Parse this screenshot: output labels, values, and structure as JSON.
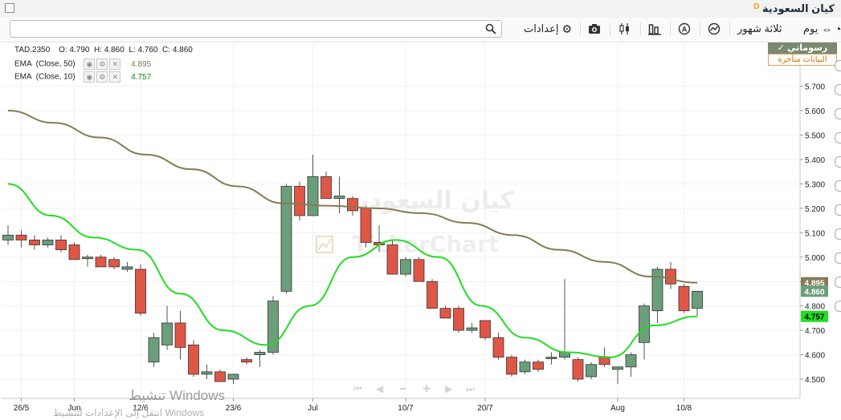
{
  "header": {
    "title": "كيان السعودية",
    "badge": "D"
  },
  "toolbar": {
    "period": "يوم",
    "range": "ثلاثة شهور",
    "settings": "إعدادات"
  },
  "legend": {
    "ticker": "TAD.2350",
    "ohlc": "O: 4.790  H: 4.860  L: 4.760  C: 4.860",
    "ema50_label": "EMA  (Close, 50)",
    "ema50_value": "4.895",
    "ema10_label": "EMA  (Close, 10)",
    "ema10_value": "4.757"
  },
  "realtime": {
    "live": "رسوماتي ✓",
    "delayed": "البيانات متأخرة"
  },
  "watermark": {
    "name": "كيان السعودية",
    "brand": "TickerChart"
  },
  "windows": {
    "line1": "تنشيط Windows",
    "line2": "انتقل إلى الإعدادات لتنشيط Windows"
  },
  "colors": {
    "up": "#6b9e7b",
    "down": "#e05646",
    "ema50": "#857b55",
    "ema10": "#22dd22"
  },
  "chart_data": {
    "type": "candlestick",
    "y_ticks": [
      "4.500",
      "4.600",
      "4.700",
      "4.800",
      "4.900",
      "5.000",
      "5.100",
      "5.200",
      "5.300",
      "5.400",
      "5.500",
      "5.600",
      "5.700"
    ],
    "ylim": [
      4.47,
      5.77
    ],
    "x_labels": [
      {
        "i": 1,
        "label": "26/5"
      },
      {
        "i": 5,
        "label": "Jun"
      },
      {
        "i": 10,
        "label": "12/6"
      },
      {
        "i": 17,
        "label": "23/6"
      },
      {
        "i": 23,
        "label": "Jul"
      },
      {
        "i": 30,
        "label": "10/7"
      },
      {
        "i": 36,
        "label": "20/7"
      },
      {
        "i": 46,
        "label": "Aug"
      },
      {
        "i": 51,
        "label": "10/8"
      }
    ],
    "candles": [
      {
        "o": 5.07,
        "h": 5.13,
        "l": 5.05,
        "c": 5.09
      },
      {
        "o": 5.09,
        "h": 5.11,
        "l": 5.04,
        "c": 5.07
      },
      {
        "o": 5.07,
        "h": 5.09,
        "l": 5.03,
        "c": 5.05
      },
      {
        "o": 5.05,
        "h": 5.08,
        "l": 5.04,
        "c": 5.07
      },
      {
        "o": 5.07,
        "h": 5.09,
        "l": 5.02,
        "c": 5.03
      },
      {
        "o": 5.05,
        "h": 5.06,
        "l": 4.99,
        "c": 4.99
      },
      {
        "o": 5.0,
        "h": 5.01,
        "l": 4.96,
        "c": 5.0
      },
      {
        "o": 5.0,
        "h": 5.01,
        "l": 4.96,
        "c": 4.96
      },
      {
        "o": 4.99,
        "h": 5.0,
        "l": 4.95,
        "c": 4.96
      },
      {
        "o": 4.95,
        "h": 4.98,
        "l": 4.94,
        "c": 4.96
      },
      {
        "o": 4.95,
        "h": 4.97,
        "l": 4.76,
        "c": 4.77
      },
      {
        "o": 4.57,
        "h": 4.69,
        "l": 4.55,
        "c": 4.67
      },
      {
        "o": 4.64,
        "h": 4.8,
        "l": 4.62,
        "c": 4.73
      },
      {
        "o": 4.73,
        "h": 4.78,
        "l": 4.58,
        "c": 4.63
      },
      {
        "o": 4.64,
        "h": 4.66,
        "l": 4.51,
        "c": 4.52
      },
      {
        "o": 4.52,
        "h": 4.56,
        "l": 4.5,
        "c": 4.53
      },
      {
        "o": 4.53,
        "h": 4.54,
        "l": 4.49,
        "c": 4.49
      },
      {
        "o": 4.5,
        "h": 4.52,
        "l": 4.48,
        "c": 4.52
      },
      {
        "o": 4.58,
        "h": 4.59,
        "l": 4.56,
        "c": 4.57
      },
      {
        "o": 4.6,
        "h": 4.62,
        "l": 4.55,
        "c": 4.61
      },
      {
        "o": 4.61,
        "h": 4.84,
        "l": 4.6,
        "c": 4.82
      },
      {
        "o": 4.86,
        "h": 5.3,
        "l": 4.85,
        "c": 5.29
      },
      {
        "o": 5.29,
        "h": 5.31,
        "l": 5.15,
        "c": 5.17
      },
      {
        "o": 5.17,
        "h": 5.42,
        "l": 5.17,
        "c": 5.33
      },
      {
        "o": 5.33,
        "h": 5.35,
        "l": 5.24,
        "c": 5.24
      },
      {
        "o": 5.24,
        "h": 5.33,
        "l": 5.18,
        "c": 5.25
      },
      {
        "o": 5.24,
        "h": 5.25,
        "l": 5.17,
        "c": 5.19
      },
      {
        "o": 5.2,
        "h": 5.21,
        "l": 5.04,
        "c": 5.06
      },
      {
        "o": 5.06,
        "h": 5.13,
        "l": 5.02,
        "c": 5.05
      },
      {
        "o": 5.05,
        "h": 5.07,
        "l": 4.93,
        "c": 4.93
      },
      {
        "o": 4.93,
        "h": 5.0,
        "l": 4.92,
        "c": 4.99
      },
      {
        "o": 4.99,
        "h": 5.0,
        "l": 4.9,
        "c": 4.9
      },
      {
        "o": 4.9,
        "h": 4.91,
        "l": 4.79,
        "c": 4.79
      },
      {
        "o": 4.79,
        "h": 4.8,
        "l": 4.75,
        "c": 4.75
      },
      {
        "o": 4.79,
        "h": 4.8,
        "l": 4.69,
        "c": 4.7
      },
      {
        "o": 4.7,
        "h": 4.73,
        "l": 4.69,
        "c": 4.71
      },
      {
        "o": 4.74,
        "h": 4.74,
        "l": 4.66,
        "c": 4.67
      },
      {
        "o": 4.67,
        "h": 4.69,
        "l": 4.58,
        "c": 4.59
      },
      {
        "o": 4.59,
        "h": 4.6,
        "l": 4.51,
        "c": 4.52
      },
      {
        "o": 4.53,
        "h": 4.58,
        "l": 4.52,
        "c": 4.57
      },
      {
        "o": 4.57,
        "h": 4.58,
        "l": 4.53,
        "c": 4.54
      },
      {
        "o": 4.59,
        "h": 4.61,
        "l": 4.56,
        "c": 4.59
      },
      {
        "o": 4.59,
        "h": 4.91,
        "l": 4.58,
        "c": 4.61
      },
      {
        "o": 4.58,
        "h": 4.59,
        "l": 4.49,
        "c": 4.5
      },
      {
        "o": 4.51,
        "h": 4.57,
        "l": 4.5,
        "c": 4.56
      },
      {
        "o": 4.59,
        "h": 4.63,
        "l": 4.55,
        "c": 4.56
      },
      {
        "o": 4.54,
        "h": 4.55,
        "l": 4.48,
        "c": 4.55
      },
      {
        "o": 4.55,
        "h": 4.61,
        "l": 4.51,
        "c": 4.6
      },
      {
        "o": 4.65,
        "h": 4.81,
        "l": 4.58,
        "c": 4.8
      },
      {
        "o": 4.78,
        "h": 4.96,
        "l": 4.73,
        "c": 4.95
      },
      {
        "o": 4.95,
        "h": 4.98,
        "l": 4.87,
        "c": 4.89
      },
      {
        "o": 4.88,
        "h": 4.89,
        "l": 4.77,
        "c": 4.78
      },
      {
        "o": 4.79,
        "h": 4.86,
        "l": 4.76,
        "c": 4.86
      }
    ],
    "ema50": [
      5.3,
      5.2,
      5.09,
      5.0,
      4.95,
      4.91,
      4.885,
      4.88,
      4.885,
      4.895
    ],
    "ema10": [
      5.08,
      5.05,
      5.0,
      4.9,
      4.7,
      4.64,
      4.88,
      5.07,
      5.01,
      4.82,
      4.65,
      4.6,
      4.62,
      4.74,
      4.757
    ]
  }
}
